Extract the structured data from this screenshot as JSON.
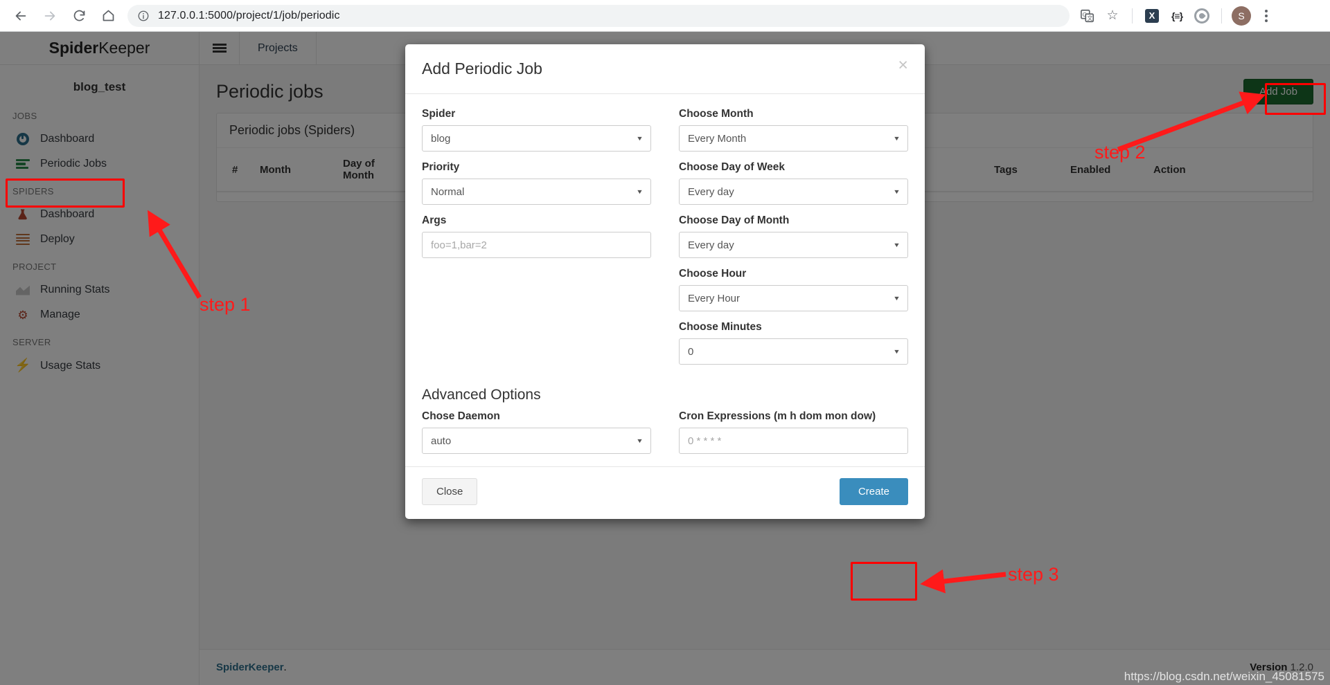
{
  "browser": {
    "url": "127.0.0.1:5000/project/1/job/periodic",
    "back_icon": "back-arrow-icon",
    "forward_icon": "forward-arrow-icon",
    "reload_icon": "reload-icon",
    "home_icon": "home-icon",
    "site_info_icon": "site-info-icon",
    "translate_icon": "translate-icon",
    "bookmark_icon": "star-icon",
    "ext_x_label": "X",
    "ext_brace_label": "{≡}",
    "avatar_label": "S",
    "menu_icon": "three-dot-menu-icon"
  },
  "app": {
    "brand_bold": "Spider",
    "brand_light": "Keeper",
    "project_name": "blog_test",
    "topbar": {
      "menu_icon": "hamburger-icon",
      "projects_label": "Projects"
    },
    "sidebar": [
      {
        "type": "section",
        "label": "JOBS"
      },
      {
        "type": "item",
        "label": "Dashboard",
        "icon": "dashboard-gauge-icon"
      },
      {
        "type": "item",
        "label": "Periodic Jobs",
        "icon": "periodic-jobs-icon",
        "highlighted": true
      },
      {
        "type": "section",
        "label": "SPIDERS"
      },
      {
        "type": "item",
        "label": "Dashboard",
        "icon": "flask-icon"
      },
      {
        "type": "item",
        "label": "Deploy",
        "icon": "server-stack-icon"
      },
      {
        "type": "section",
        "label": "PROJECT"
      },
      {
        "type": "item",
        "label": "Running Stats",
        "icon": "area-chart-icon"
      },
      {
        "type": "item",
        "label": "Manage",
        "icon": "gears-icon"
      },
      {
        "type": "section",
        "label": "SERVER"
      },
      {
        "type": "item",
        "label": "Usage Stats",
        "icon": "bolt-icon"
      }
    ],
    "page": {
      "title": "Periodic jobs",
      "add_job_label": "Add Job",
      "panel_title": "Periodic jobs (Spiders)",
      "table_headers": [
        "#",
        "Month",
        "Day of Month",
        "Tags",
        "Enabled",
        "Action"
      ]
    },
    "footer": {
      "link": "SpiderKeeper",
      "dot": ".",
      "version_label": "Version",
      "version_number": "1.2.0"
    }
  },
  "modal": {
    "title": "Add Periodic Job",
    "close_icon": "close-icon",
    "left_fields": [
      {
        "label": "Spider",
        "value": "blog",
        "kind": "select"
      },
      {
        "label": "Priority",
        "value": "Normal",
        "kind": "select"
      },
      {
        "label": "Args",
        "placeholder": "foo=1,bar=2",
        "kind": "input"
      }
    ],
    "right_fields": [
      {
        "label": "Choose Month",
        "value": "Every Month",
        "kind": "select"
      },
      {
        "label": "Choose Day of Week",
        "value": "Every day",
        "kind": "select"
      },
      {
        "label": "Choose Day of Month",
        "value": "Every day",
        "kind": "select"
      },
      {
        "label": "Choose Hour",
        "value": "Every Hour",
        "kind": "select"
      },
      {
        "label": "Choose Minutes",
        "value": "0",
        "kind": "select"
      }
    ],
    "advanced_title": "Advanced Options",
    "advanced_left": {
      "label": "Chose Daemon",
      "value": "auto",
      "kind": "select"
    },
    "advanced_right": {
      "label": "Cron Expressions (m h dom mon dow)",
      "placeholder": "0 * * * *",
      "kind": "input"
    },
    "close_label": "Close",
    "create_label": "Create"
  },
  "annotations": {
    "step1": "step 1",
    "step2": "step 2",
    "step3": "step 3",
    "color": "#ff1a1a"
  },
  "watermark": "https://blog.csdn.net/weixin_45081575"
}
